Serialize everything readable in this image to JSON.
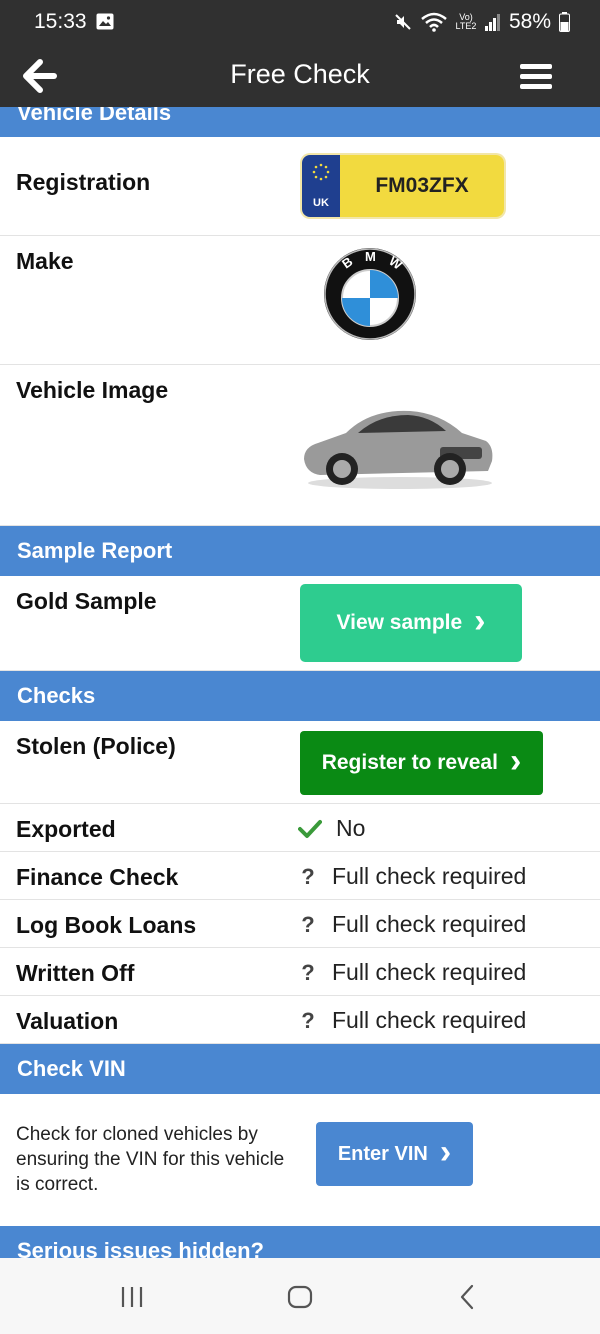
{
  "status_bar": {
    "time": "15:33",
    "network": "Vo) LTE2",
    "battery": "58%"
  },
  "app_bar": {
    "title": "Free Check"
  },
  "vehicle": {
    "header_partial": "Vehicle Details",
    "registration_label": "Registration",
    "plate_country": "UK",
    "plate_number": "FM03ZFX",
    "make_label": "Make",
    "make_logo_text": "BMW",
    "image_label": "Vehicle Image"
  },
  "sample": {
    "header": "Sample Report",
    "label": "Gold Sample",
    "button": "View sample"
  },
  "checks": {
    "header": "Checks",
    "stolen_label": "Stolen (Police)",
    "reveal_button": "Register to reveal",
    "rows": [
      {
        "label": "Exported",
        "value": "No",
        "icon": "check-icon"
      },
      {
        "label": "Finance Check",
        "value": "Full check required",
        "icon": "question-icon"
      },
      {
        "label": "Log Book Loans",
        "value": "Full check required",
        "icon": "question-icon"
      },
      {
        "label": "Written Off",
        "value": "Full check required",
        "icon": "question-icon"
      },
      {
        "label": "Valuation",
        "value": "Full check required",
        "icon": "question-icon"
      }
    ]
  },
  "vin": {
    "header": "Check VIN",
    "description": "Check for cloned vehicles by ensuring the VIN for this vehicle is correct.",
    "button": "Enter VIN"
  },
  "next_section": {
    "header_partial": "Serious issues hidden?"
  },
  "colors": {
    "section": "#4a87d1",
    "teal_button": "#2ecc8f",
    "green_button": "#0a8a14",
    "blue_button": "#4a87d1",
    "check": "#3a9a3a"
  }
}
